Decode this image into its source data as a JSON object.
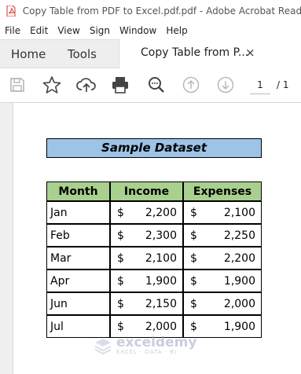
{
  "window": {
    "title": "Copy Table from PDF to Excel.pdf.pdf - Adobe Acrobat Reader DC"
  },
  "menu": [
    "File",
    "Edit",
    "View",
    "Sign",
    "Window",
    "Help"
  ],
  "tabs": {
    "home": "Home",
    "tools": "Tools",
    "document": "Copy Table from P...",
    "close": "×"
  },
  "toolbar": {
    "icons": [
      "save-icon",
      "star-icon",
      "upload-cloud-icon",
      "print-icon",
      "search-zoom-icon",
      "page-up-icon",
      "page-down-icon"
    ],
    "current_page": "1",
    "page_total": "/ 1"
  },
  "document": {
    "title": "Sample Dataset",
    "headers": [
      "Month",
      "Income",
      "Expenses"
    ],
    "rows": [
      {
        "month": "Jan",
        "income": "2,200",
        "expenses": "2,100"
      },
      {
        "month": "Feb",
        "income": "2,300",
        "expenses": "2,250"
      },
      {
        "month": "Mar",
        "income": "2,100",
        "expenses": "2,200"
      },
      {
        "month": "Apr",
        "income": "1,900",
        "expenses": "1,900"
      },
      {
        "month": "Jun",
        "income": "2,150",
        "expenses": "2,000"
      },
      {
        "month": "Jul",
        "income": "2,000",
        "expenses": "1,900"
      }
    ],
    "currency": "$"
  },
  "watermark": {
    "name": "exceldemy",
    "tagline": "EXCEL · DATA · BI"
  },
  "colors": {
    "title_fill": "#9dc3e6",
    "header_fill": "#a9d08e",
    "pdf_red": "#d4312b"
  }
}
